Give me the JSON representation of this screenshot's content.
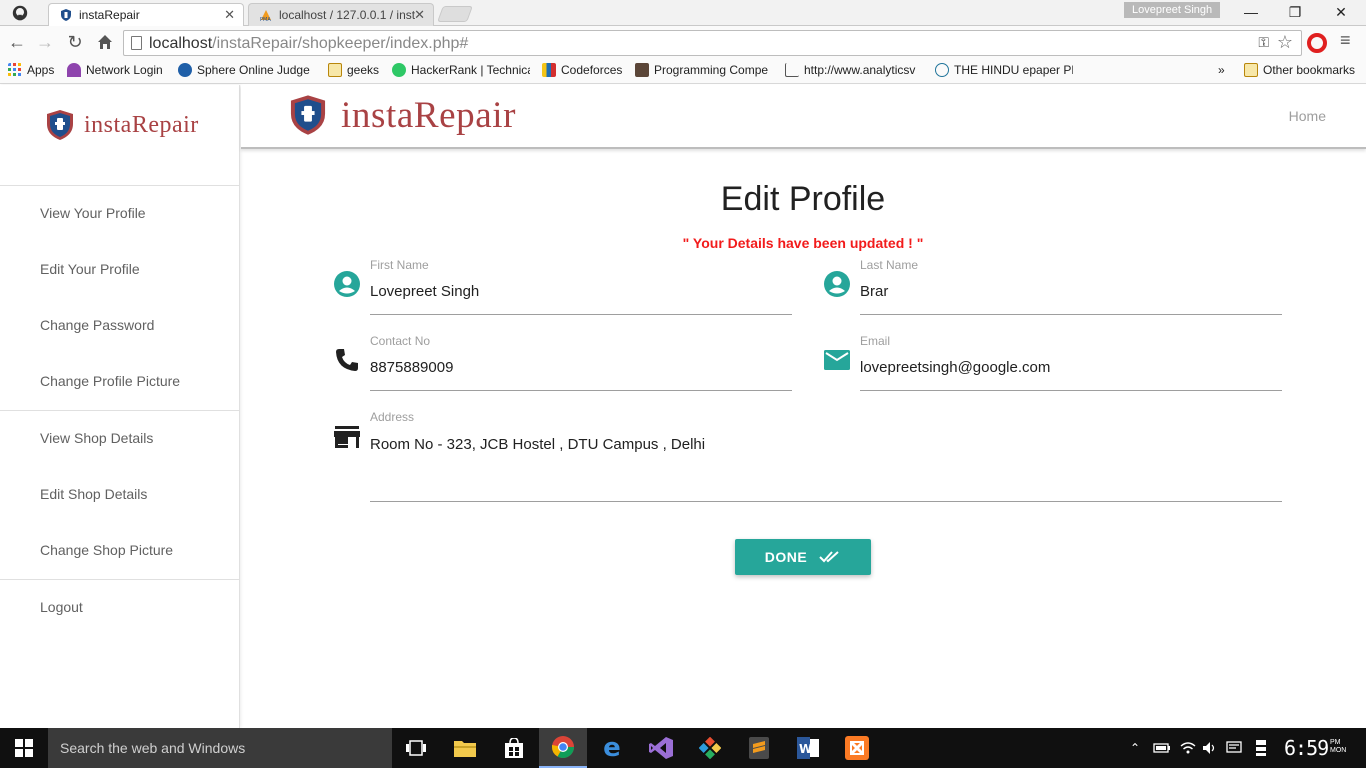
{
  "browser": {
    "tabs": [
      {
        "title": "instaRepair",
        "active": true
      },
      {
        "title": "localhost / 127.0.0.1 / inst",
        "active": false
      }
    ],
    "profile_name": "Lovepreet Singh",
    "url_host": "localhost",
    "url_path": "/instaRepair/shopkeeper/index.php#",
    "bookmarks": [
      "Apps",
      "Network Login",
      "Sphere Online Judge",
      "geeks",
      "HackerRank | Technica",
      "Codeforces",
      "Programming Compe",
      "http://www.analyticsv",
      "THE HINDU epaper PE",
      "»",
      "Other bookmarks"
    ]
  },
  "app": {
    "brand": "instaRepair",
    "header": {
      "home_link": "Home"
    },
    "sidebar": {
      "items": [
        "View Your Profile",
        "Edit Your Profile",
        "Change Password",
        "Change Profile Picture",
        "View Shop Details",
        "Edit Shop Details",
        "Change Shop Picture",
        "Logout"
      ]
    },
    "main": {
      "title": "Edit Profile",
      "status_message": "\" Your Details have been updated ! \"",
      "fields": {
        "first_name": {
          "label": "First Name",
          "value": "Lovepreet Singh",
          "icon": "account-circle-icon"
        },
        "last_name": {
          "label": "Last Name",
          "value": "Brar",
          "icon": "account-circle-icon"
        },
        "contact": {
          "label": "Contact No",
          "value": "8875889009",
          "icon": "phone-icon"
        },
        "email": {
          "label": "Email",
          "value": "lovepreetsingh@google.com",
          "icon": "mail-icon"
        },
        "address": {
          "label": "Address",
          "value": "Room No - 323, JCB Hostel , DTU Campus , Delhi",
          "icon": "store-icon"
        }
      },
      "done_button": "DONE"
    },
    "colors": {
      "accent": "#26a69a",
      "brand": "#a94244",
      "status": "#f21b1b"
    }
  },
  "taskbar": {
    "search_placeholder": "Search the web and Windows",
    "time": "6:59",
    "ampm": "PM",
    "day": "MON"
  }
}
